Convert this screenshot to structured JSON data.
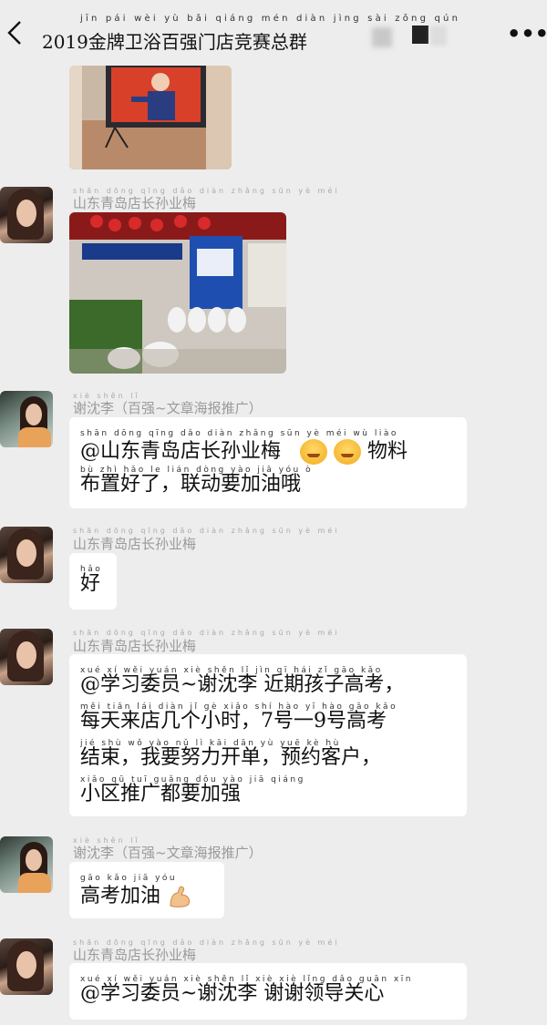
{
  "header": {
    "title": "2019金牌卫浴百强门店竞赛总群",
    "title_pinyin": "jīn pái wèi yù bǎi qiáng mén diàn jìng sài zǒng qún"
  },
  "messages": [
    {
      "sender": "山东青岛店长孙业梅",
      "sender_pinyin": "shān dōng qīng dǎo diàn zhǎng sūn yè méi",
      "type": "image",
      "image_desc": "store-display-tv"
    },
    {
      "sender": "谢沈李（百强~文章海报推广）",
      "sender_pinyin": "xiè shěn lǐ",
      "lines": [
        {
          "pinyin": "shān dōng qīng dǎo diàn zhǎng sūn yè méi        wù liào",
          "text": "@山东青岛店长孙业梅"
        },
        {
          "pinyin": "bù  zhì  hǎo  le     lián dòng yào jiā  yóu  ò",
          "text": "布置好了，联动要加油哦"
        }
      ],
      "suffix": "物料"
    },
    {
      "sender": "山东青岛店长孙业梅",
      "sender_pinyin": "shān dōng qīng dǎo diàn zhǎng sūn yè méi",
      "lines": [
        {
          "pinyin": "hǎo",
          "text": "好"
        }
      ]
    },
    {
      "sender": "山东青岛店长孙业梅",
      "sender_pinyin": "shān dōng qīng dǎo diàn zhǎng sūn yè méi",
      "lines": [
        {
          "pinyin": "xué  xí  wěi yuán     xiè shěn  lǐ      jìn  qī  hái  zǐ  gāo kǎo",
          "text": "@学习委员~谢沈李 近期孩子高考，"
        },
        {
          "pinyin": "měi tiān lái diàn  jǐ   gè  xiǎo shí        hào  yī      hào gāo kǎo",
          "text": "每天来店几个小时，7号一9号高考"
        },
        {
          "pinyin": "jié shù    wǒ  yào  nǔ  lì  kāi dān     yù  yuē  kè  hù",
          "text": "结束，我要努力开单，预约客户，"
        },
        {
          "pinyin": "xiǎo qū  tuī guǎng dōu yào jiā qiáng",
          "text": "小区推广都要加强"
        }
      ]
    },
    {
      "sender": "谢沈李（百强~文章海报推广）",
      "sender_pinyin": "xiè shěn lǐ",
      "lines": [
        {
          "pinyin": "gāo kǎo jiā  yóu",
          "text": "高考加油"
        }
      ]
    },
    {
      "sender": "山东青岛店长孙业梅",
      "sender_pinyin": "shān dōng qīng dǎo diàn zhǎng sūn yè méi",
      "lines": [
        {
          "pinyin": "xué  xí  wěi yuán     xiè shěn  lǐ      xiè  xiè  lǐng dǎo guān xīn",
          "text": "@学习委员~谢沈李 谢谢领导关心"
        }
      ]
    }
  ],
  "icons": {
    "back": "back-arrow-icon",
    "more": "more-dots-icon"
  }
}
